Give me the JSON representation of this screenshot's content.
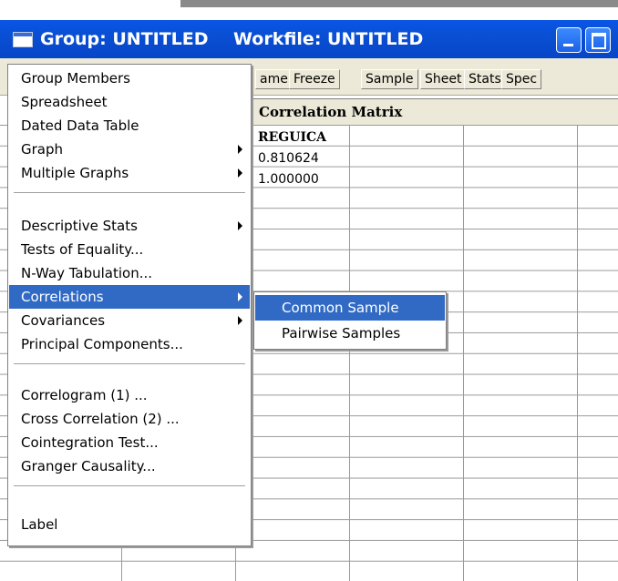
{
  "window": {
    "title_group": "Group: UNTITLED",
    "title_workfile": "Workfile: UNTITLED"
  },
  "toolbar": {
    "buttons": [
      "ame",
      "Freeze",
      "Sample",
      "Sheet",
      "Stats",
      "Spec"
    ]
  },
  "spreadsheet": {
    "header_title": "Correlation Matrix",
    "column_header": "REGUICA",
    "values": [
      "0.810624",
      "1.000000"
    ]
  },
  "menu": {
    "items": [
      {
        "label": "Group Members"
      },
      {
        "label": "Spreadsheet"
      },
      {
        "label": "Dated Data Table"
      },
      {
        "label": "Graph",
        "submenu": true
      },
      {
        "label": "Multiple Graphs",
        "submenu": true
      },
      {
        "label": "Descriptive Stats",
        "submenu": true
      },
      {
        "label": "Tests of Equality..."
      },
      {
        "label": "N-Way Tabulation..."
      },
      {
        "label": "Correlations",
        "submenu": true,
        "selected": true
      },
      {
        "label": "Covariances",
        "submenu": true
      },
      {
        "label": "Principal Components..."
      },
      {
        "label": "Correlogram (1) ..."
      },
      {
        "label": "Cross Correlation (2) ..."
      },
      {
        "label": "Cointegration Test..."
      },
      {
        "label": "Granger Causality..."
      },
      {
        "label": "Label"
      }
    ]
  },
  "submenu": {
    "items": [
      {
        "label": "Common Sample",
        "selected": true
      },
      {
        "label": "Pairwise Samples"
      }
    ]
  },
  "colors": {
    "titlebar": "#0a4fd4",
    "selection": "#316ac5",
    "toolbar": "#ece9d8"
  }
}
